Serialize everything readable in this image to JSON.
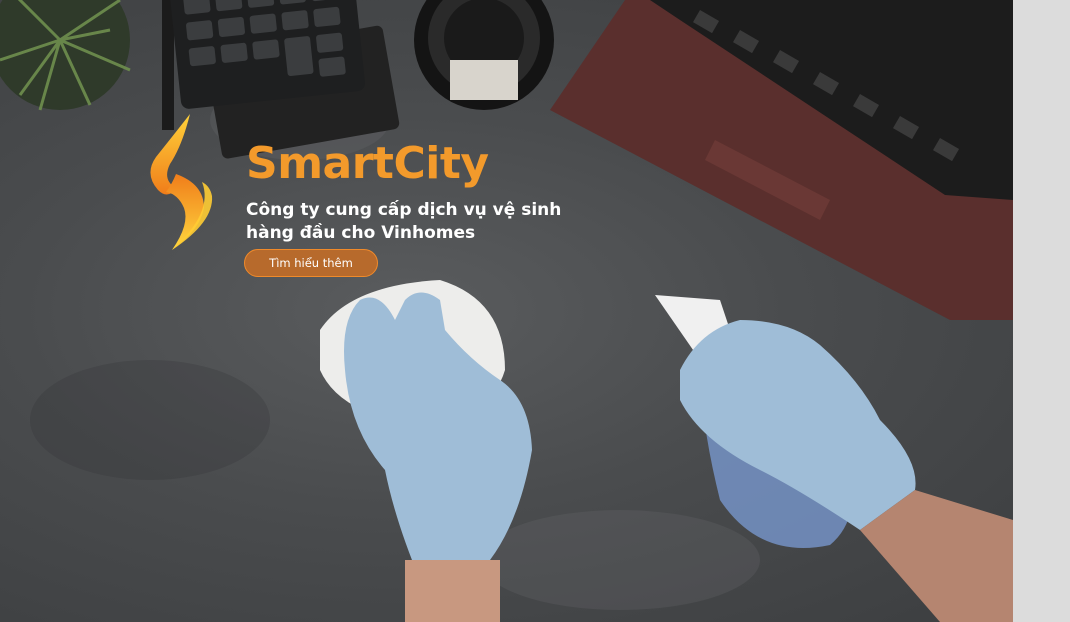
{
  "brand": {
    "name": "SmartCity",
    "tagline_line1": "Công ty cung cấp dịch vụ vệ sinh",
    "tagline_line2": "hàng đầu cho Vinhomes",
    "logo_icon": "flame-s-logo-icon"
  },
  "cta": {
    "label": "Tìm hiểu thêm"
  },
  "background": {
    "description_icon": "cleaning-hero-image"
  },
  "colors": {
    "brand_orange": "#f39a2b",
    "cta_fill": "#b76a2c",
    "cta_border": "#f08a2a",
    "text_white": "#ffffff"
  }
}
